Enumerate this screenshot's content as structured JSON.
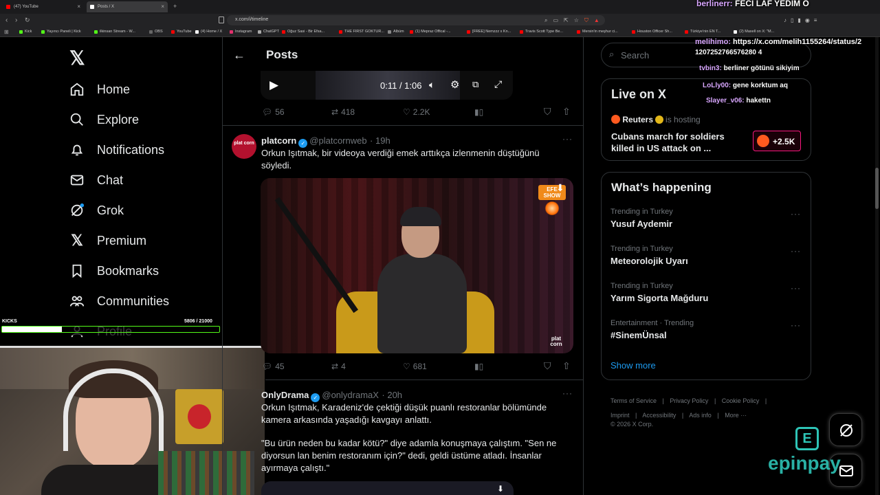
{
  "browser": {
    "tabs": [
      {
        "title": "(47) YouTube",
        "color": "#ff0000"
      },
      {
        "title": "Posts / X",
        "color": "#ffffff",
        "active": true
      }
    ],
    "url": "x.com/i/timeline",
    "bookmarks": [
      {
        "label": "Kick",
        "color": "#53fc18"
      },
      {
        "label": "Yayıncı Paneli | Kick",
        "color": "#53fc18"
      },
      {
        "label": "ilkinsan Stream - W...",
        "color": "#53fc18"
      },
      {
        "label": "OBS",
        "color": "#666666"
      },
      {
        "label": "YouTube",
        "color": "#ff0000"
      },
      {
        "label": "(4) Home / X",
        "color": "#ffffff"
      },
      {
        "label": "Instagram",
        "color": "#e1306c"
      },
      {
        "label": "ChatGPT",
        "color": "#aaaaaa"
      },
      {
        "label": "Oğuz Sasi - Bir Efsa...",
        "color": "#ff0000"
      },
      {
        "label": "THE FIRST GOKTUR...",
        "color": "#ff0000"
      },
      {
        "label": "Albüm",
        "color": "#888888"
      },
      {
        "label": "(1) Mepraz Offical -...",
        "color": "#ff0000"
      },
      {
        "label": "[FREE] Nemzzz x Kn...",
        "color": "#ff0000"
      },
      {
        "label": "Travis Scott Type Be...",
        "color": "#ff0000"
      },
      {
        "label": "Mersin'in meşhur ci...",
        "color": "#ff0000"
      },
      {
        "label": "Houston Officer Sh...",
        "color": "#ff0000"
      },
      {
        "label": "Türkiye'nin EN T...",
        "color": "#ff0000"
      },
      {
        "label": "(2) Maxell on X: \"M...",
        "color": "#ffffff"
      }
    ]
  },
  "sidebar": {
    "items": [
      {
        "label": "Home",
        "icon": "home-icon"
      },
      {
        "label": "Explore",
        "icon": "search-icon"
      },
      {
        "label": "Notifications",
        "icon": "bell-icon"
      },
      {
        "label": "Chat",
        "icon": "mail-icon"
      },
      {
        "label": "Grok",
        "icon": "grok-icon"
      },
      {
        "label": "Premium",
        "icon": "x-icon"
      },
      {
        "label": "Bookmarks",
        "icon": "bookmark-icon"
      },
      {
        "label": "Communities",
        "icon": "communities-icon"
      },
      {
        "label": "Profile",
        "icon": "person-icon"
      }
    ]
  },
  "kicks": {
    "label": "KICKS",
    "count": "5806  / 21000",
    "progress": 0.276
  },
  "header": {
    "title": "Posts"
  },
  "video_player": {
    "time": "0:11 / 1:06"
  },
  "post0": {
    "replies": "56",
    "reposts": "418",
    "likes": "2.2K"
  },
  "post1": {
    "name": "platcorn",
    "handle": "@platcornweb",
    "time": "· 19h",
    "avatar_text": "plat corn",
    "text": "Orkun Işıtmak, bir videoya verdiği emek arttıkça izlenmenin düştüğünü söyledi.",
    "media_badge": "EFE SHOW",
    "watermark": "plat corn",
    "replies": "45",
    "reposts": "4",
    "likes": "681"
  },
  "post2": {
    "name": "OnlyDrama",
    "handle": "@onlydramaX",
    "time": "· 20h",
    "text1": "Orkun Işıtmak, Karadeniz'de çektiği düşük puanlı restoranlar bölümünde kamera arkasında yaşadığı kavgayı anlattı.",
    "text2": "\"Bu ürün neden bu kadar kötü?\" diye adamla konuşmaya çalıştım. \"Sen ne diyorsun lan benim restoranım için?\" dedi, geldi üstüme atladı. İnsanlar ayırmaya çalıştı.\""
  },
  "search": {
    "placeholder": "Search"
  },
  "live": {
    "title": "Live on X",
    "host": "Reuters",
    "hosting": "is hosting",
    "headline": "Cubans march for soldiers killed in US attack on ...",
    "count": "+2.5K"
  },
  "happening": {
    "title": "What’s happening",
    "trends": [
      {
        "sub": "Trending in Turkey",
        "title": "Yusuf Aydemir"
      },
      {
        "sub": "Trending in Turkey",
        "title": "Meteorolojik Uyarı"
      },
      {
        "sub": "Trending in Turkey",
        "title": "Yarım Sigorta Mağduru"
      },
      {
        "sub": "Entertainment · Trending",
        "title": "#SinemÜnsal"
      }
    ],
    "show_more": "Show more"
  },
  "footer": {
    "links": [
      "Terms of Service",
      "Privacy Policy",
      "Cookie Policy",
      "Imprint",
      "Accessibility",
      "Ads info",
      "More ···"
    ],
    "copyright": "© 2026 X Corp."
  },
  "chat": {
    "lines": [
      {
        "user": "berlinerr:",
        "msg": "FECİ LAF YEDİM O"
      },
      {
        "user": "melihimo:",
        "msg": "https://x.com/melih1155264/status/2"
      },
      {
        "user": "",
        "msg": "1207252766576280 4"
      },
      {
        "user": "tvbin3:",
        "msg": "berliner götünü sikiyim"
      },
      {
        "user": "LoLly00:",
        "msg": "gene korktum aq"
      },
      {
        "user": "Slayer_v06:",
        "msg": "hakettn"
      }
    ]
  },
  "sponsor": {
    "brand": "epinpay"
  }
}
